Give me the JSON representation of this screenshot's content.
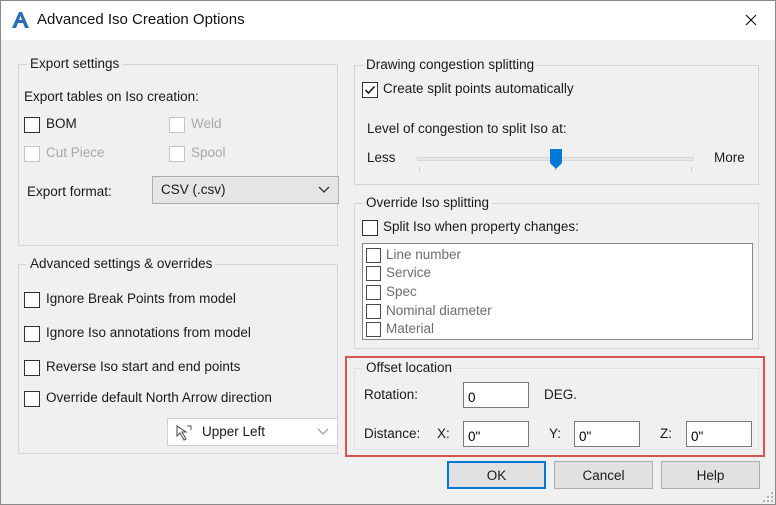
{
  "window": {
    "title": "Advanced Iso Creation Options",
    "close_glyph": "✕",
    "app_icon": "autocad-a-icon"
  },
  "export_settings": {
    "title": "Export settings",
    "tables_label": "Export tables on Iso creation:",
    "tables": [
      {
        "label": "BOM",
        "checked": false,
        "enabled": true
      },
      {
        "label": "Weld",
        "checked": false,
        "enabled": false
      },
      {
        "label": "Cut Piece",
        "checked": false,
        "enabled": false
      },
      {
        "label": "Spool",
        "checked": false,
        "enabled": false
      }
    ],
    "format_label": "Export format:",
    "format_value": "CSV (.csv)"
  },
  "advanced": {
    "title": "Advanced settings & overrides",
    "options": [
      {
        "label": "Ignore Break Points from model",
        "checked": false
      },
      {
        "label": "Ignore Iso annotations from model",
        "checked": false
      },
      {
        "label": "Reverse Iso start and end points",
        "checked": false
      },
      {
        "label": "Override default North Arrow direction",
        "checked": false
      }
    ],
    "north_arrow_value": "Upper Left"
  },
  "congestion": {
    "title": "Drawing congestion splitting",
    "auto_label": "Create split points automatically",
    "auto_checked": true,
    "level_label": "Level of congestion to split Iso at:",
    "less": "Less",
    "more": "More",
    "level_fraction": 0.5
  },
  "override_split": {
    "title": "Override Iso splitting",
    "split_label": "Split Iso when property changes:",
    "split_checked": false,
    "properties": [
      "Line number",
      "Service",
      "Spec",
      "Nominal diameter",
      "Material"
    ]
  },
  "offset": {
    "title": "Offset location",
    "rotation_label": "Rotation:",
    "rotation_value": "0",
    "rotation_unit": "DEG.",
    "distance_label": "Distance:",
    "x_label": "X:",
    "x_value": "0\"",
    "y_label": "Y:",
    "y_value": "0\"",
    "z_label": "Z:",
    "z_value": "0\""
  },
  "buttons": {
    "ok": "OK",
    "cancel": "Cancel",
    "help": "Help"
  },
  "colors": {
    "highlight": "#d9534f",
    "accent": "#0078d7",
    "slider_thumb": "#0078d7"
  }
}
